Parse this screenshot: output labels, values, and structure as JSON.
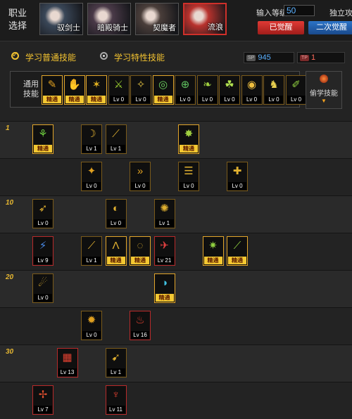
{
  "header": {
    "job_label": "职业选择",
    "classes": [
      {
        "name": "驭剑士",
        "active": false,
        "tone": "#3a4758"
      },
      {
        "name": "暗殿骑士",
        "active": false,
        "tone": "#4a3a48"
      },
      {
        "name": "契魔者",
        "active": false,
        "tone": "#4a3e3a"
      },
      {
        "name": "流浪",
        "active": true,
        "tone": "#b8322d"
      }
    ],
    "level_label": "输入等级",
    "level_value": "50",
    "independent_label": "独立攻",
    "awakened_button": "已觉醒",
    "second_awakening_button": "二次觉醒"
  },
  "modes": {
    "normal_label": "学习普通技能",
    "special_label": "学习特性技能",
    "sp_tag": "SP",
    "sp_value": "945",
    "tp_tag": "TP",
    "tp_value": "1"
  },
  "general": {
    "label": "通用技能",
    "steal_label": "偷学技能",
    "skills": [
      {
        "name": "general-skill-1",
        "badge": "精通",
        "mastered": true,
        "glyph": "✎",
        "color": "#e0a020"
      },
      {
        "name": "general-skill-2",
        "badge": "精通",
        "mastered": true,
        "glyph": "✋",
        "color": "#e8a030"
      },
      {
        "name": "general-skill-3",
        "badge": "精通",
        "mastered": true,
        "glyph": "✶",
        "color": "#e0b020"
      },
      {
        "name": "general-skill-4",
        "badge": "Lv 0",
        "mastered": false,
        "glyph": "⚔",
        "color": "#9bd030"
      },
      {
        "name": "general-skill-5",
        "badge": "Lv 0",
        "mastered": false,
        "glyph": "✧",
        "color": "#e2c040"
      },
      {
        "name": "general-skill-6",
        "badge": "精通",
        "mastered": true,
        "glyph": "◎",
        "color": "#6dd060"
      },
      {
        "name": "general-skill-7",
        "badge": "Lv 0",
        "mastered": false,
        "glyph": "⊕",
        "color": "#60c060"
      },
      {
        "name": "general-skill-8",
        "badge": "Lv 0",
        "mastered": false,
        "glyph": "❧",
        "color": "#a0d040"
      },
      {
        "name": "general-skill-9",
        "badge": "Lv 0",
        "mastered": false,
        "glyph": "☘",
        "color": "#b0e050"
      },
      {
        "name": "general-skill-10",
        "badge": "Lv 0",
        "mastered": false,
        "glyph": "◉",
        "color": "#f0c040"
      },
      {
        "name": "general-skill-11",
        "badge": "Lv 0",
        "mastered": false,
        "glyph": "♞",
        "color": "#e8d050"
      },
      {
        "name": "general-skill-12",
        "badge": "Lv 0",
        "mastered": false,
        "glyph": "✐",
        "color": "#90d040"
      }
    ]
  },
  "tree": [
    {
      "level": "1",
      "skills": [
        {
          "badge": "精通",
          "mastered": true,
          "glyph": "⚘",
          "color": "#70d040",
          "col": 0
        },
        {
          "badge": "Lv 1",
          "mastered": false,
          "glyph": "☽",
          "color": "#e0b030",
          "col": 2
        },
        {
          "badge": "Lv 1",
          "mastered": false,
          "glyph": "⟋",
          "color": "#e0b030",
          "col": 3
        },
        {
          "badge": "精通",
          "mastered": true,
          "glyph": "✸",
          "color": "#a0d040",
          "col": 6
        }
      ]
    },
    {
      "level": "",
      "skills": [
        {
          "badge": "Lv 0",
          "mastered": false,
          "glyph": "✦",
          "color": "#e0a020",
          "col": 2
        },
        {
          "badge": "Lv 0",
          "mastered": false,
          "glyph": "»",
          "color": "#e0a020",
          "col": 4
        },
        {
          "badge": "Lv 0",
          "mastered": false,
          "glyph": "☰",
          "color": "#e0b030",
          "col": 6
        },
        {
          "badge": "Lv 0",
          "mastered": false,
          "glyph": "✚",
          "color": "#e0b030",
          "col": 8
        }
      ]
    },
    {
      "level": "10",
      "skills": [
        {
          "badge": "Lv 0",
          "mastered": false,
          "glyph": "➶",
          "color": "#e0b030",
          "col": 0
        },
        {
          "badge": "Lv 0",
          "mastered": false,
          "glyph": "◐",
          "color": "#e0b030",
          "col": 3
        },
        {
          "badge": "Lv 1",
          "mastered": false,
          "glyph": "✺",
          "color": "#e0b030",
          "col": 5
        }
      ]
    },
    {
      "level": "",
      "skills": [
        {
          "badge": "Lv 9",
          "mastered": false,
          "glyph": "⚡",
          "color": "#4a8ae8",
          "col": 0,
          "red": true
        },
        {
          "badge": "Lv 1",
          "mastered": false,
          "glyph": "⟋",
          "color": "#e0b030",
          "col": 2
        },
        {
          "badge": "精通",
          "mastered": true,
          "glyph": "Λ",
          "color": "#e0b030",
          "col": 3
        },
        {
          "badge": "精通",
          "mastered": true,
          "glyph": "◌",
          "color": "#e0b030",
          "col": 4
        },
        {
          "badge": "Lv 21",
          "mastered": false,
          "glyph": "✈",
          "color": "#e04040",
          "col": 5,
          "red": true
        },
        {
          "badge": "精通",
          "mastered": true,
          "glyph": "✷",
          "color": "#90d040",
          "col": 7
        },
        {
          "badge": "精通",
          "mastered": true,
          "glyph": "⟋",
          "color": "#90d040",
          "col": 8
        }
      ]
    },
    {
      "level": "20",
      "skills": [
        {
          "badge": "Lv 0",
          "mastered": false,
          "glyph": "☄",
          "color": "#e0b030",
          "col": 0
        },
        {
          "badge": "精通",
          "mastered": true,
          "glyph": "◑",
          "color": "#40c0e0",
          "col": 5
        }
      ]
    },
    {
      "level": "",
      "skills": [
        {
          "badge": "Lv 0",
          "mastered": false,
          "glyph": "✹",
          "color": "#e0a020",
          "col": 2
        },
        {
          "badge": "Lv 16",
          "mastered": false,
          "glyph": "♨",
          "color": "#e04030",
          "col": 4,
          "red": true
        }
      ]
    },
    {
      "level": "30",
      "skills": [
        {
          "badge": "Lv 13",
          "mastered": false,
          "glyph": "▦",
          "color": "#e04030",
          "col": 1,
          "red": true
        },
        {
          "badge": "Lv 1",
          "mastered": false,
          "glyph": "➹",
          "color": "#e0b030",
          "col": 3
        }
      ]
    },
    {
      "level": "",
      "skills": [
        {
          "badge": "Lv 7",
          "mastered": false,
          "glyph": "✢",
          "color": "#e05030",
          "col": 0,
          "red": true
        },
        {
          "badge": "Lv 11",
          "mastered": false,
          "glyph": "♆",
          "color": "#e04030",
          "col": 3,
          "red": true
        }
      ]
    }
  ]
}
